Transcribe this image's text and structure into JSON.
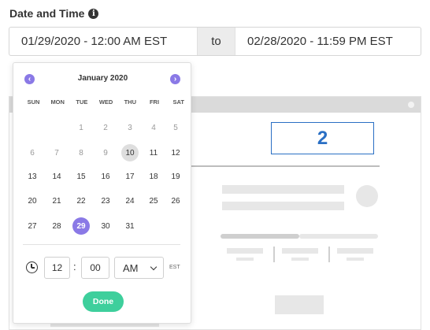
{
  "field": {
    "label": "Date and Time",
    "info_icon": "info-icon"
  },
  "range": {
    "start": "01/29/2020 - 12:00 AM EST",
    "separator": "to",
    "end": "02/28/2020 - 11:59 PM EST"
  },
  "calendar": {
    "month_title": "January 2020",
    "prev_icon": "chevron-left-icon",
    "next_icon": "chevron-right-icon",
    "weekdays": [
      "SUN",
      "MON",
      "TUE",
      "WED",
      "THU",
      "FRI",
      "SAT"
    ],
    "weeks": [
      [
        "",
        "",
        "1",
        "2",
        "3",
        "4",
        "5"
      ],
      [
        "6",
        "7",
        "8",
        "9",
        "10",
        "11",
        "12"
      ],
      [
        "13",
        "14",
        "15",
        "16",
        "17",
        "18",
        "19"
      ],
      [
        "20",
        "21",
        "22",
        "23",
        "24",
        "25",
        "26"
      ],
      [
        "27",
        "28",
        "29",
        "30",
        "31",
        "",
        ""
      ]
    ],
    "today": "10",
    "selected": "29",
    "accent_color": "#8a79e6"
  },
  "time": {
    "clock_icon": "clock-icon",
    "hour": "12",
    "separator": ":",
    "minute": "00",
    "ampm": "AM",
    "timezone": "EST"
  },
  "done_button": {
    "label": "Done",
    "color": "#3ecf9c"
  },
  "background_preview": {
    "number": "2",
    "number_color": "#2a6fc4"
  }
}
